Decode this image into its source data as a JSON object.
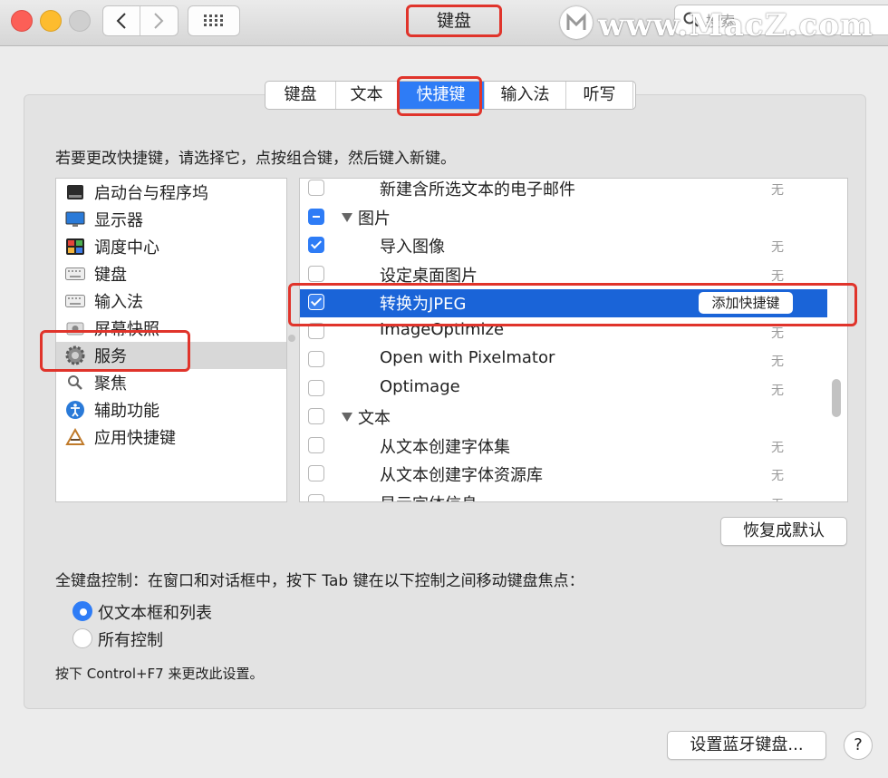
{
  "window": {
    "title": "键盘",
    "search_placeholder": "搜索",
    "watermark": "www.MacZ.com"
  },
  "tabs": [
    {
      "label": "键盘",
      "w": 78
    },
    {
      "label": "文本",
      "w": 68
    },
    {
      "label": "快捷键",
      "w": 96
    },
    {
      "label": "输入法",
      "w": 90
    },
    {
      "label": "听写",
      "w": 74
    }
  ],
  "instruction": "若要更改快捷键，请选择它，点按组合键，然后键入新键。",
  "categories": [
    {
      "label": "启动台与程序坞",
      "icon": "dock-icon"
    },
    {
      "label": "显示器",
      "icon": "display-icon"
    },
    {
      "label": "调度中心",
      "icon": "mission-control-icon"
    },
    {
      "label": "键盘",
      "icon": "keyboard-icon"
    },
    {
      "label": "输入法",
      "icon": "input-keyboard-icon"
    },
    {
      "label": "屏幕快照",
      "icon": "screenshot-icon"
    },
    {
      "label": "服务",
      "icon": "gear-icon"
    },
    {
      "label": "聚焦",
      "icon": "spotlight-icon"
    },
    {
      "label": "辅助功能",
      "icon": "accessibility-icon"
    },
    {
      "label": "应用快捷键",
      "icon": "app-shortcuts-icon"
    }
  ],
  "services": [
    {
      "label": "新建含所选文本的电子邮件",
      "shortcut": "无",
      "state": "off",
      "group": false
    },
    {
      "label": "图片",
      "shortcut": "",
      "state": "mixed",
      "group": true
    },
    {
      "label": "导入图像",
      "shortcut": "无",
      "state": "on",
      "group": false
    },
    {
      "label": "设定桌面图片",
      "shortcut": "无",
      "state": "off",
      "group": false
    },
    {
      "label": "转换为JPEG",
      "shortcut": "",
      "state": "on",
      "group": false,
      "selected": true
    },
    {
      "label": "ImageOptimize",
      "shortcut": "无",
      "state": "off",
      "group": false
    },
    {
      "label": "Open with Pixelmator",
      "shortcut": "无",
      "state": "off",
      "group": false
    },
    {
      "label": "Optimage",
      "shortcut": "无",
      "state": "off",
      "group": false
    },
    {
      "label": "文本",
      "shortcut": "",
      "state": "off",
      "group": true
    },
    {
      "label": "从文本创建字体集",
      "shortcut": "无",
      "state": "off",
      "group": false
    },
    {
      "label": "从文本创建字体资源库",
      "shortcut": "无",
      "state": "off",
      "group": false
    },
    {
      "label": "显示字体信息",
      "shortcut": "无",
      "state": "off",
      "group": false
    }
  ],
  "add_shortcut_label": "添加快捷键",
  "reset_label": "恢复成默认",
  "full_keyboard_label": "全键盘控制：在窗口和对话框中，按下 Tab 键在以下控制之间移动键盘焦点：",
  "radio": {
    "option1": "仅文本框和列表",
    "option2": "所有控制"
  },
  "note": "按下 Control+F7 来更改此设置。",
  "bluetooth_label": "设置蓝牙键盘...",
  "help_label": "?",
  "colors": {
    "accent": "#2e7cf6",
    "selection": "#1a64d8",
    "highlight": "#e0342b"
  }
}
